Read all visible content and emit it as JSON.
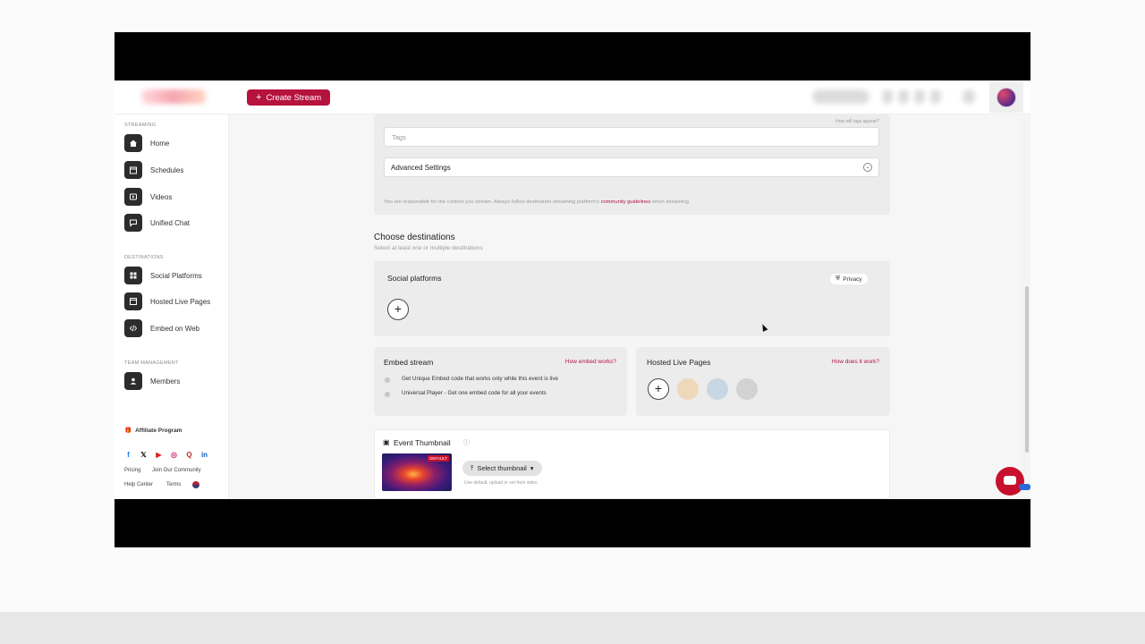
{
  "topbar": {
    "create_stream_label": "Create Stream"
  },
  "sidebar": {
    "streaming_label": "STREAMING",
    "destinations_label": "DESTINATIONS",
    "team_label": "TEAM MANAGEMENT",
    "items": [
      {
        "label": "Home",
        "icon": "home-icon"
      },
      {
        "label": "Schedules",
        "icon": "calendar-icon"
      },
      {
        "label": "Videos",
        "icon": "video-icon"
      },
      {
        "label": "Unified Chat",
        "icon": "chat-icon"
      },
      {
        "label": "Social Platforms",
        "icon": "grid-icon"
      },
      {
        "label": "Hosted Live Pages",
        "icon": "page-icon"
      },
      {
        "label": "Embed on Web",
        "icon": "code-icon"
      },
      {
        "label": "Members",
        "icon": "members-icon"
      }
    ],
    "affiliate": "Affiliate Program",
    "links": {
      "pricing": "Pricing",
      "community": "Join Our Community",
      "help": "Help Center",
      "terms": "Terms"
    }
  },
  "main": {
    "tags_hint": "How will tags appear?",
    "tags_placeholder": "Tags",
    "advanced_settings": "Advanced Settings",
    "disclaimer_pre": "You are responsible for the content you stream. Always follow destination streaming platform's ",
    "disclaimer_link": "community guidelines",
    "disclaimer_post": " when streaming.",
    "choose_title": "Choose destinations",
    "choose_sub": "Select at least one or multiple destinations",
    "social_title": "Social platforms",
    "privacy": "Privacy",
    "embed": {
      "title": "Embed stream",
      "help": "How embed works?",
      "option1": "Get Unique Embed code that works only while this event is live",
      "option2": "Universal Player - Get one embed code for all your events"
    },
    "hosted": {
      "title": "Hosted Live Pages",
      "help": "How does it work?"
    },
    "thumbnail": {
      "title": "Event Thumbnail",
      "badge": "DEFAULT",
      "select": "Select thumbnail",
      "hint": "Use default, upload or set from video"
    }
  },
  "colors": {
    "accent": "#b5123e",
    "sidebar_icon_bg": "#2c2c2c"
  }
}
